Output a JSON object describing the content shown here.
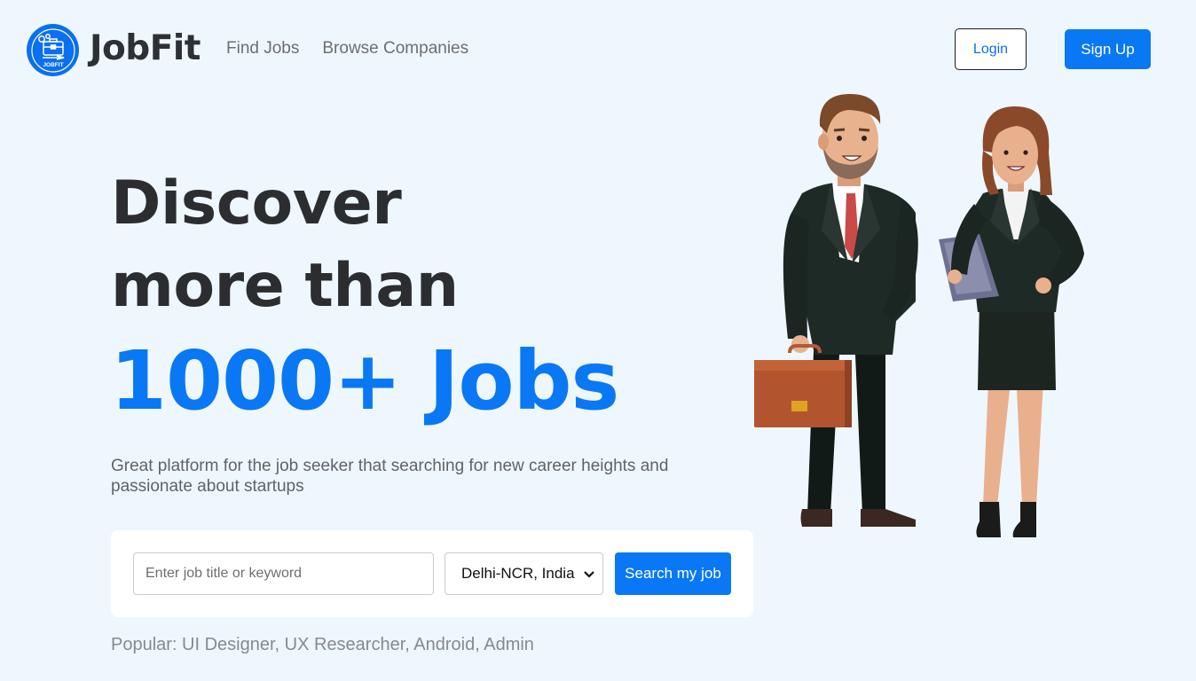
{
  "header": {
    "brand": "JobFit",
    "logo_text": "JOBFIT",
    "nav": [
      "Find Jobs",
      "Browse Companies"
    ],
    "login_label": "Login",
    "signup_label": "Sign Up"
  },
  "hero": {
    "line1": "Discover",
    "line2": "more than",
    "line3": "1000+ Jobs",
    "description": "Great platform for the job seeker that searching for new career heights and passionate about startups"
  },
  "search": {
    "placeholder": "Enter job title or keyword",
    "location": "Delhi-NCR, India",
    "button_label": "Search my job"
  },
  "popular": "Popular: UI Designer, UX Researcher, Android, Admin",
  "colors": {
    "background": "#eff7fe",
    "accent": "#0a78f5",
    "heading": "#2b2d31"
  },
  "icons": {
    "logo": "briefcase-logo-icon",
    "select_arrow": "chevron-down-icon"
  }
}
